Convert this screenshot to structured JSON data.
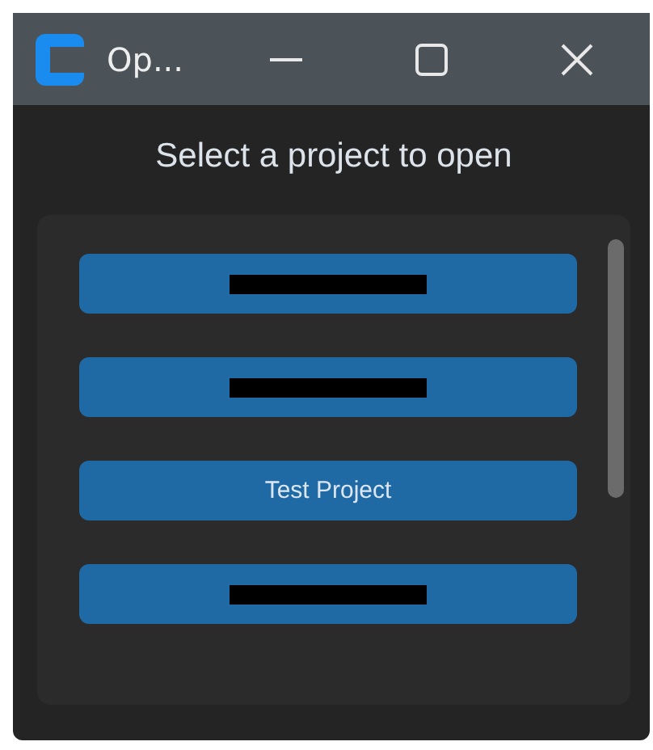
{
  "window": {
    "title": "Op..."
  },
  "heading": "Select a project to open",
  "projects": [
    {
      "kind": "redacted"
    },
    {
      "kind": "redacted"
    },
    {
      "kind": "named",
      "label": "Test Project"
    },
    {
      "kind": "redacted"
    }
  ]
}
